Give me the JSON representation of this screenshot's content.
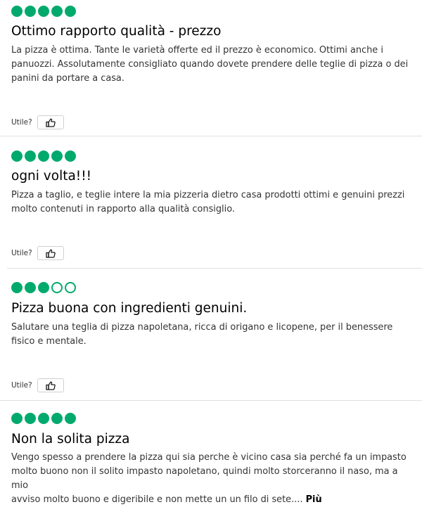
{
  "colors": {
    "bubble": "#00aa6c",
    "text": "#333333",
    "divider": "#e0e0e0"
  },
  "icons": {
    "helpful": "thumbs-up-icon",
    "rating": "rating-bubble-icon"
  },
  "reviews": [
    {
      "rating": 5,
      "max_rating": 5,
      "title": "Ottimo rapporto qualità - prezzo",
      "body_lines": [
        "La pizza è ottima. Tante le varietà offerte ed il prezzo è economico. Ottimi anche i",
        "panuozzi. Assolutamente consigliato quando dovete prendere delle teglie di pizza o dei",
        "panini da portare a casa."
      ],
      "helpful_label": "Utile?"
    },
    {
      "rating": 5,
      "max_rating": 5,
      "title": "ogni volta!!!",
      "body_lines": [
        "Pizza a taglio, e teglie intere la mia pizzeria dietro casa prodotti ottimi e genuini prezzi",
        "molto contenuti in rapporto alla qualità consiglio."
      ],
      "helpful_label": "Utile?"
    },
    {
      "rating": 3,
      "max_rating": 5,
      "title": "Pizza buona con ingredienti genuini.",
      "body_lines": [
        "Salutare una teglia di pizza napoletana, ricca di origano e licopene, per il benessere",
        "fisico e mentale."
      ],
      "helpful_label": "Utile?"
    },
    {
      "rating": 5,
      "max_rating": 5,
      "title": "Non la solita pizza",
      "body_lines": [
        "Vengo spesso a prendere la pizza qui sia perche è vicino casa sia perché fa un impasto",
        "molto buono non il solito impasto napoletano, quindi molto storceranno il naso, ma a mio",
        "avviso molto buono e digeribile e non mette un un filo di sete...."
      ],
      "more_label": "Più"
    }
  ]
}
